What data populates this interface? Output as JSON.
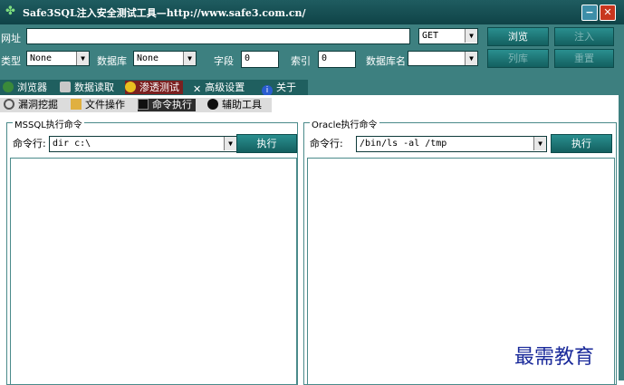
{
  "window": {
    "title": "Safe3SQL注入安全测试工具—http://www.safe3.com.cn/",
    "minimize": "−",
    "close": "✕"
  },
  "toolbar": {
    "url_label": "网址",
    "url_value": "",
    "method_value": "GET",
    "browse_label": "浏览",
    "inject_label": "注入",
    "type_label": "类型",
    "type_value": "None",
    "db_label": "数据库",
    "db_value": "None",
    "field_label": "字段",
    "field_value": "0",
    "index_label": "索引",
    "index_value": "0",
    "dbname_label": "数据库名",
    "dbname_value": "",
    "list_db_label": "列库",
    "reset_label": "重置"
  },
  "main_tabs": [
    {
      "label": "浏览器",
      "active": false
    },
    {
      "label": "数据读取",
      "active": false
    },
    {
      "label": "渗透测试",
      "active": true
    },
    {
      "label": "高级设置",
      "active": false
    },
    {
      "label": "关于",
      "active": false
    }
  ],
  "sub_tabs": [
    {
      "label": "漏洞挖掘",
      "active": false
    },
    {
      "label": "文件操作",
      "active": false
    },
    {
      "label": "命令执行",
      "active": true
    },
    {
      "label": "辅助工具",
      "active": false
    }
  ],
  "mssql": {
    "title": "MSSQL执行命令",
    "cmd_label": "命令行:",
    "cmd_value": "dir c:\\",
    "exec_label": "执行"
  },
  "oracle": {
    "title": "Oracle执行命令",
    "cmd_label": "命令行:",
    "cmd_value": "/bin/ls -al /tmp",
    "exec_label": "执行"
  },
  "watermark": "最需教育",
  "colors": {
    "titlebar": "#0f4347",
    "panel": "#3d8080",
    "active_tab": "#7a2020",
    "button": "#135f5f"
  }
}
